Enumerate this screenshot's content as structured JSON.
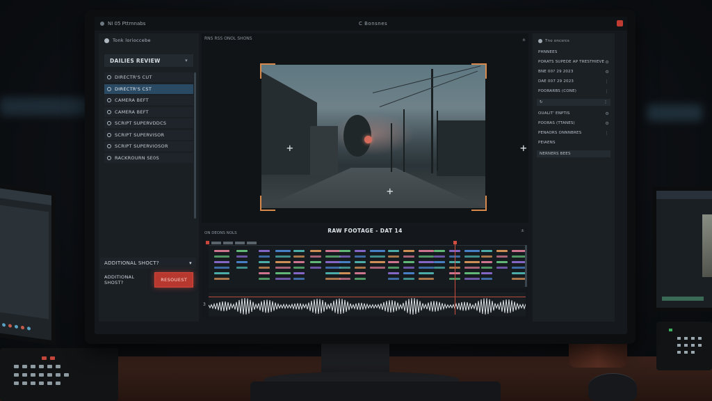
{
  "window": {
    "title_left": "NI 05 Pttrnnabs",
    "title_center": "C Bonsnes"
  },
  "left_panel": {
    "profile_label": "Tonk lorioccebe",
    "section_title": "DAILIES REVIEW",
    "items": [
      {
        "label": "DIRECTR'S CUT",
        "active": false
      },
      {
        "label": "DIRECTR'S CST",
        "active": true
      },
      {
        "label": "CAMERA BEFT",
        "active": false
      },
      {
        "label": "CAMERA BEFT",
        "active": false
      },
      {
        "label": "SCRIPT SUPERVDDCS",
        "active": false
      },
      {
        "label": "SCRIPT SUPERVISOR",
        "active": false
      },
      {
        "label": "SCRIPT SUPERVIOSOR",
        "active": false
      },
      {
        "label": "RACKROURN SE0S",
        "active": false
      }
    ],
    "additional_title": "ADDITIONAL SHOCT?",
    "additional_label": "ADDITIONAL SHOST?",
    "request_button": "RESOUEST"
  },
  "viewer": {
    "header_label": "RNS RSS ONOL SHONS",
    "zoom_label": "±"
  },
  "right_panel": {
    "header": "Tno oncsrcs",
    "rows": [
      "PHNNEES",
      "PORATS SUPEDE AP TRESTHIEVE",
      "BNE 00? 29 2023",
      "DAE 007 29 2023",
      "POORARBS (CONE)",
      "OUALIT' ENPTIS",
      "POORAS (TTANES)",
      "PENAORS ONNNBRES",
      "PEIAENS",
      "NERNERS BEES"
    ]
  },
  "timeline": {
    "title": "RAW FOOTAGE - DAT 14",
    "left_label": "ON DEONS NOLS",
    "track_number": "3",
    "zoom_label": "±"
  },
  "colors": {
    "accent_red": "#d14d3f",
    "selection_blue": "#2a4a63",
    "frame_orange": "#d78a4c",
    "clip_pink": "#d77a96",
    "clip_green": "#64c07c",
    "clip_purple": "#8a6ad0",
    "clip_blue": "#4b86d0",
    "clip_teal": "#4fb4b0",
    "clip_orange": "#d9955a"
  }
}
